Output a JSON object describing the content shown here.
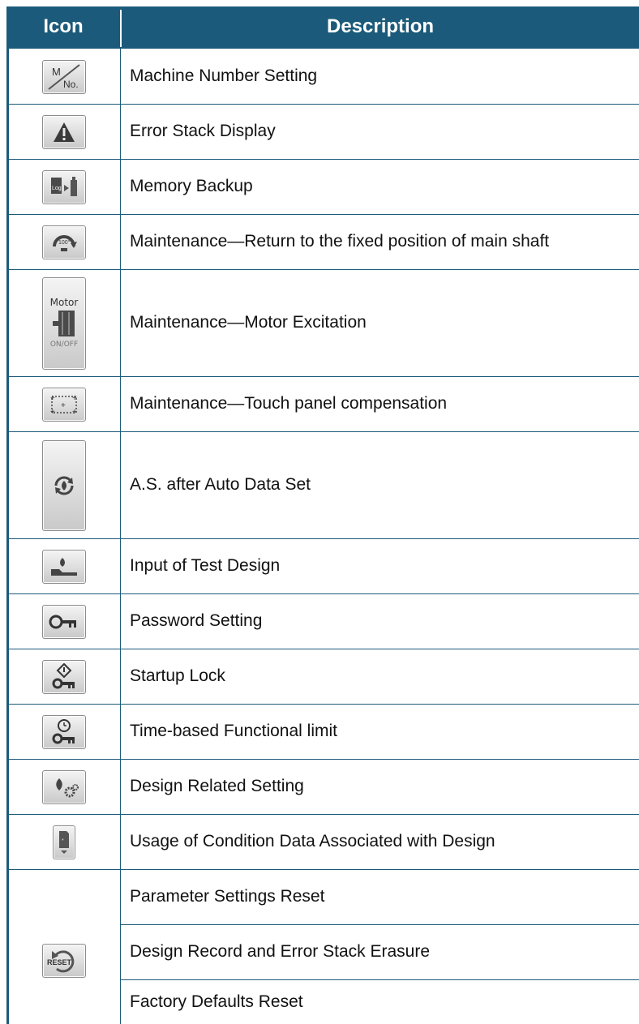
{
  "header": {
    "icon_label": "Icon",
    "description_label": "Description"
  },
  "rows": [
    {
      "icon": "machine-number-icon",
      "description": "Machine Number Setting",
      "icon_text": "M No."
    },
    {
      "icon": "warning-icon",
      "description": "Error Stack Display"
    },
    {
      "icon": "memory-backup-icon",
      "description": "Memory Backup",
      "icon_text": "Log"
    },
    {
      "icon": "main-shaft-position-icon",
      "description": "Maintenance—Return to the fixed position of main shaft",
      "icon_text": "100°"
    },
    {
      "icon": "motor-excitation-icon",
      "description": "Maintenance—Motor Excitation",
      "icon_text": "Motor",
      "icon_subtext": "ON/OFF"
    },
    {
      "icon": "touch-panel-compensation-icon",
      "description": "Maintenance—Touch panel compensation"
    },
    {
      "icon": "auto-data-set-icon",
      "description": "A.S. after Auto Data Set"
    },
    {
      "icon": "test-design-icon",
      "description": "Input of Test Design"
    },
    {
      "icon": "key-icon",
      "description": "Password Setting"
    },
    {
      "icon": "startup-lock-icon",
      "description": "Startup Lock"
    },
    {
      "icon": "time-limit-icon",
      "description": "Time-based Functional limit"
    },
    {
      "icon": "design-settings-icon",
      "description": "Design Related Setting"
    },
    {
      "icon": "condition-data-icon",
      "description": "Usage of Condition Data Associated with Design"
    }
  ],
  "reset_group": {
    "icon": "reset-icon",
    "icon_text": "RESET",
    "items": [
      "Parameter Settings Reset",
      "Design Record and Error Stack Erasure",
      "Factory Defaults Reset"
    ]
  },
  "colors": {
    "header_bg": "#1b5a7a",
    "header_text": "#ffffff",
    "grid": "#1b5a7a",
    "button_face": "#d8d8d8"
  }
}
